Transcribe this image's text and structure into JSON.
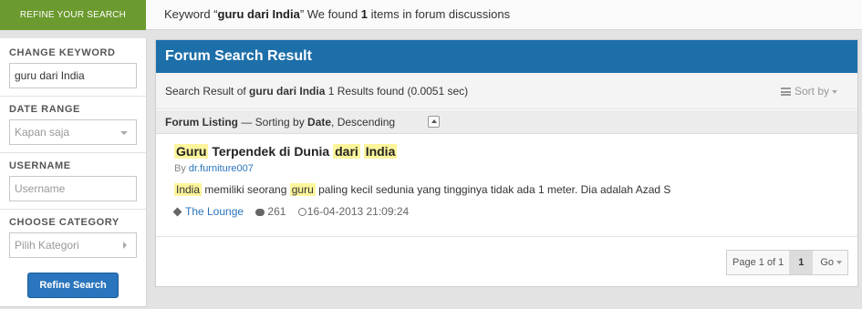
{
  "top_bar": {
    "refine_tab_label": "REFINE YOUR SEARCH",
    "summary_prefix": "Keyword “",
    "summary_keyword": "guru dari India",
    "summary_middle": "” We found ",
    "summary_count": "1",
    "summary_suffix": " items in forum discussions"
  },
  "sidebar": {
    "keyword_label": "CHANGE KEYWORD",
    "keyword_value": "guru dari India",
    "date_label": "DATE RANGE",
    "date_value": "Kapan saja",
    "username_label": "USERNAME",
    "username_placeholder": "Username",
    "category_label": "CHOOSE CATEGORY",
    "category_value": "Pilih Kategori",
    "refine_button": "Refine Search"
  },
  "main": {
    "header_title": "Forum Search Result",
    "result_prefix": "Search Result of ",
    "result_keyword": "guru dari India",
    "result_count_text": " 1 Results found (0.0051 sec)",
    "sort_label": "Sort by",
    "listing_title": "Forum Listing",
    "listing_sep": " — Sorting by ",
    "listing_field": "Date",
    "listing_order": ", Descending"
  },
  "results": [
    {
      "title_parts": [
        "Guru",
        "Terpendek di Dunia",
        "dari",
        "India"
      ],
      "author_prefix": "By ",
      "author": "dr.furniture007",
      "snippet_parts": [
        "India",
        "memiliki seorang",
        "guru",
        "paling kecil sedunia yang tingginya tidak ada 1 meter. Dia adalah Azad S"
      ],
      "category": "The Lounge",
      "replies": "261",
      "date": "16-04-2013 21:09:24"
    }
  ],
  "pagination": {
    "info": "Page 1 of 1",
    "current": "1",
    "go_label": "Go"
  },
  "colors": {
    "accent_green": "#6b9a2e",
    "header_blue": "#1d6fa9",
    "button_blue": "#2a75bd",
    "highlight_yellow": "#fcf59b"
  }
}
